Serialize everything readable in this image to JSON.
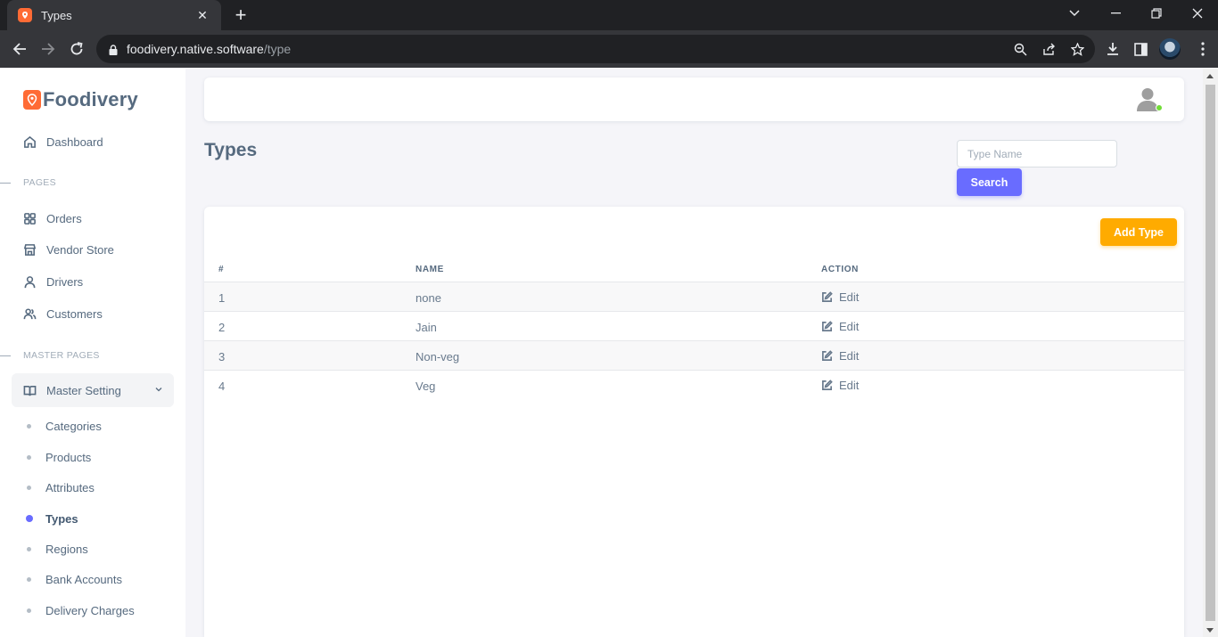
{
  "browser": {
    "tab_title": "Types",
    "url_host": "foodivery.native.software",
    "url_path": "/type"
  },
  "sidebar": {
    "brand": "Foodivery",
    "dashboard": "Dashboard",
    "pages_heading": "PAGES",
    "pages": [
      "Orders",
      "Vendor Store",
      "Drivers",
      "Customers"
    ],
    "master_heading": "MASTER PAGES",
    "master_setting": "Master Setting",
    "sub_items": [
      "Categories",
      "Products",
      "Attributes",
      "Types",
      "Regions",
      "Bank Accounts",
      "Delivery Charges"
    ],
    "active_item": "Types"
  },
  "main": {
    "title": "Types",
    "search_placeholder": "Type Name",
    "search_label": "Search",
    "add_label": "Add Type",
    "columns": [
      "#",
      "NAME",
      "ACTION"
    ],
    "rows": [
      {
        "num": "1",
        "name": "none",
        "action": "Edit"
      },
      {
        "num": "2",
        "name": "Jain",
        "action": "Edit"
      },
      {
        "num": "3",
        "name": "Non-veg",
        "action": "Edit"
      },
      {
        "num": "4",
        "name": "Veg",
        "action": "Edit"
      }
    ]
  },
  "colors": {
    "primary": "#696cff",
    "warning": "#ffab00",
    "brand": "#ff6b35",
    "online": "#71dd37"
  }
}
